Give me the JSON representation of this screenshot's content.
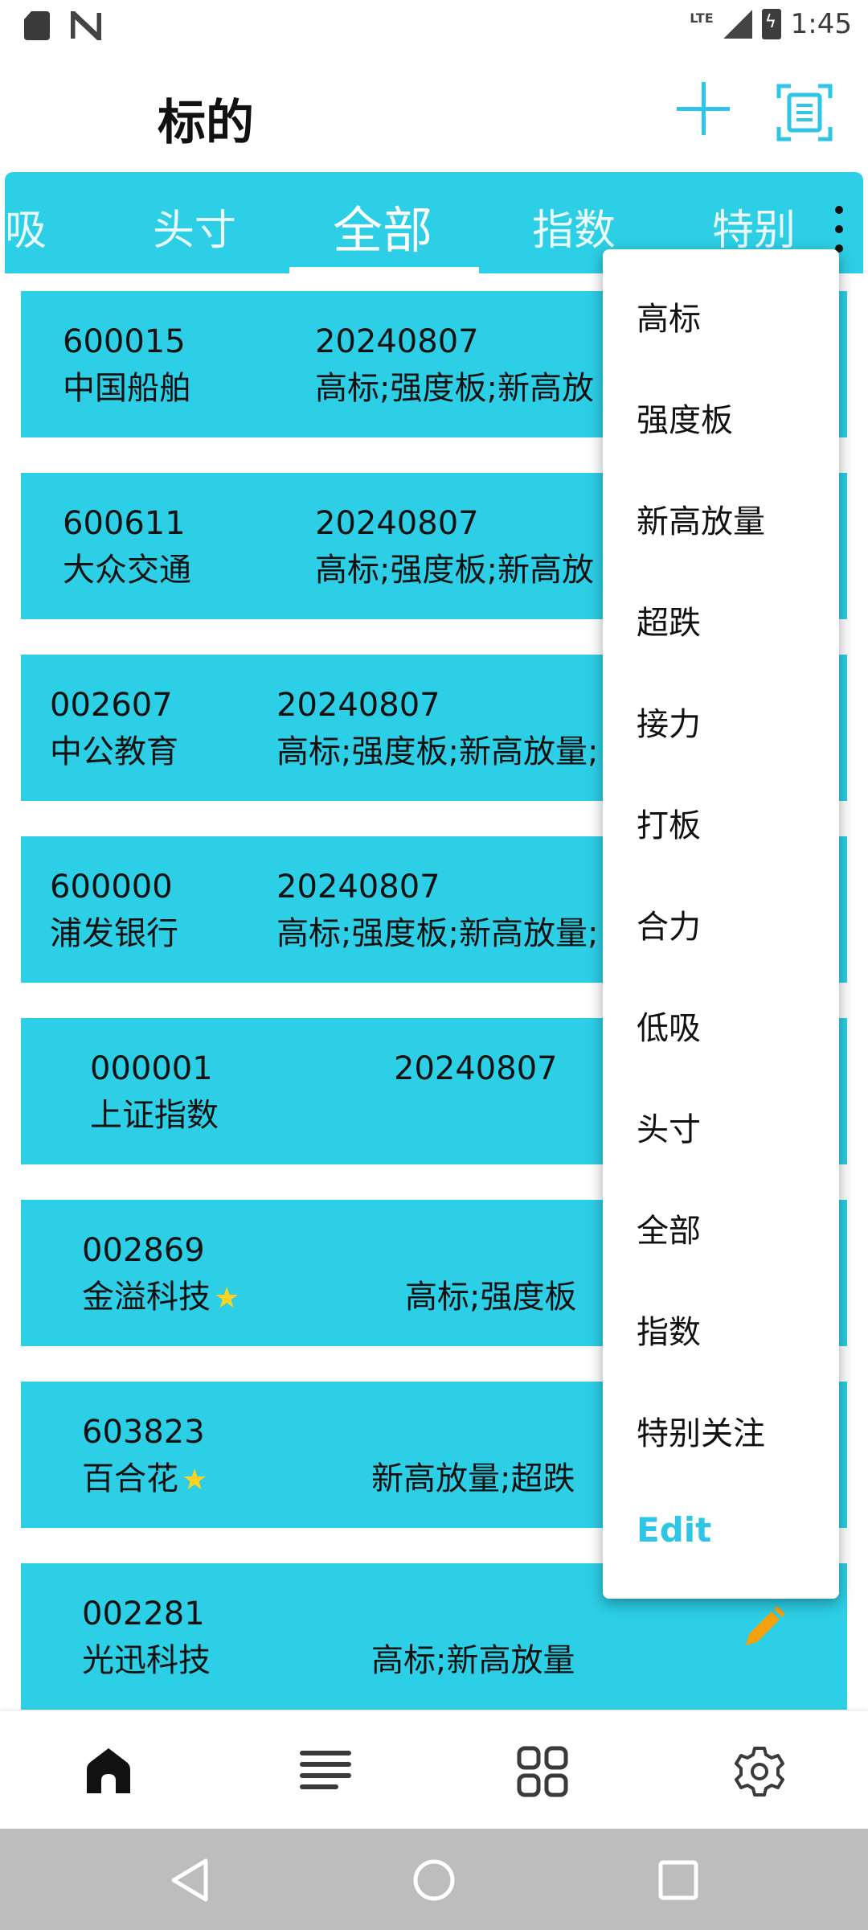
{
  "status_bar": {
    "network": "LTE",
    "time": "1:45",
    "icons": [
      "sd-card-icon",
      "n-icon",
      "signal-icon",
      "battery-charging-icon"
    ]
  },
  "header": {
    "title": "标的",
    "icons": [
      "add-icon",
      "scan-document-icon"
    ]
  },
  "tabs": {
    "items": [
      "吸",
      "头寸",
      "全部",
      "指数",
      "特别"
    ],
    "active": "全部"
  },
  "list": [
    {
      "code": "600015",
      "name": "中国船舶",
      "date": "20240807",
      "tags": "高标;强度板;新高放",
      "starred": false
    },
    {
      "code": "600611",
      "name": "大众交通",
      "date": "20240807",
      "tags": "高标;强度板;新高放",
      "starred": false
    },
    {
      "code": "002607",
      "name": "中公教育",
      "date": "20240807",
      "tags": "高标;强度板;新高放量;",
      "starred": false
    },
    {
      "code": "600000",
      "name": "浦发银行",
      "date": "20240807",
      "tags": "高标;强度板;新高放量;",
      "starred": false
    },
    {
      "code": "000001",
      "name": "上证指数",
      "date": "20240807",
      "tags": "",
      "starred": false
    },
    {
      "code": "002869",
      "name": "金溢科技",
      "date": "",
      "tags": "高标;强度板",
      "starred": true
    },
    {
      "code": "603823",
      "name": "百合花",
      "date": "",
      "tags": "新高放量;超跌",
      "starred": true
    },
    {
      "code": "002281",
      "name": "光迅科技",
      "date": "",
      "tags": "高标;新高放量",
      "starred": false
    }
  ],
  "menu": {
    "items": [
      "高标",
      "强度板",
      "新高放量",
      "超跌",
      "接力",
      "打板",
      "合力",
      "低吸",
      "头寸",
      "全部",
      "指数",
      "特别关注"
    ],
    "edit_label": "Edit"
  },
  "colors": {
    "accent": "#2ccfe6",
    "star": "#ffd21f",
    "pencil": "#f5a20a"
  }
}
